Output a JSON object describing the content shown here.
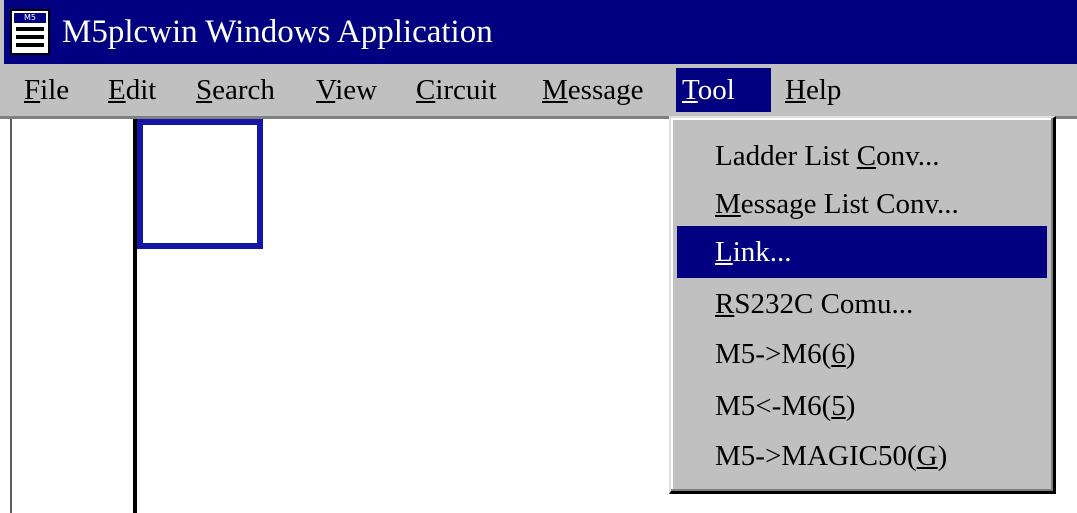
{
  "window": {
    "title": "M5plcwin Windows Application",
    "icon": "app-document-icon"
  },
  "menubar": {
    "items": [
      {
        "pre": "",
        "u": "F",
        "post": "ile"
      },
      {
        "pre": "",
        "u": "E",
        "post": "dit"
      },
      {
        "pre": "",
        "u": "S",
        "post": "earch"
      },
      {
        "pre": "",
        "u": "V",
        "post": "iew"
      },
      {
        "pre": "",
        "u": "C",
        "post": "ircuit"
      },
      {
        "pre": "",
        "u": "M",
        "post": "essage"
      },
      {
        "pre": "",
        "u": "T",
        "post": "ool"
      },
      {
        "pre": "",
        "u": "H",
        "post": "elp"
      }
    ],
    "active": "Tool"
  },
  "tool_menu": {
    "items": [
      {
        "pre": "Ladder List ",
        "u": "C",
        "post": "onv..."
      },
      {
        "pre": "",
        "u": "M",
        "post": "essage List Conv..."
      },
      {
        "pre": "",
        "u": "L",
        "post": "ink..."
      },
      {
        "pre": "",
        "u": "R",
        "post": "S232C Comu..."
      },
      {
        "pre": "M5->M6(",
        "u": "6",
        "post": ")"
      },
      {
        "pre": "M5<-M6(",
        "u": "5",
        "post": ")"
      },
      {
        "pre": "M5->MAGIC50(",
        "u": "G",
        "post": ")"
      }
    ],
    "highlighted": "Link..."
  },
  "colors": {
    "titlebar": "#000080",
    "menu_face": "#c0c0c0",
    "highlight": "#000080",
    "cursor_box": "#1515a8"
  }
}
